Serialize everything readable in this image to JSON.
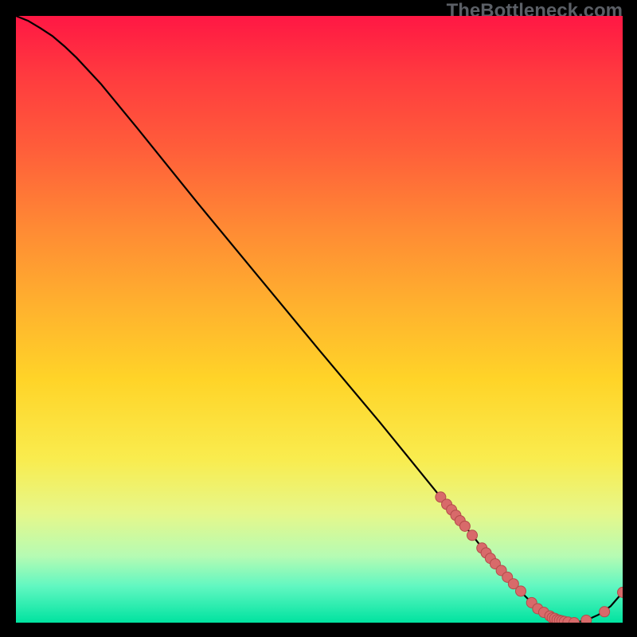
{
  "watermark": "TheBottleneck.com",
  "colors": {
    "page_bg": "#000000",
    "gradient_top": "#ff1744",
    "gradient_bottom": "#00e3a0",
    "curve": "#000000",
    "dot_fill": "#d86a6a",
    "dot_stroke": "#b44b4b"
  },
  "chart_data": {
    "type": "line",
    "title": "",
    "xlabel": "",
    "ylabel": "",
    "xlim": [
      0,
      100
    ],
    "ylim": [
      0,
      100
    ],
    "grid": false,
    "series": [
      {
        "name": "curve",
        "x": [
          0,
          2,
          4,
          6,
          8,
          10,
          14,
          20,
          30,
          40,
          50,
          60,
          70,
          75,
          78,
          80,
          82,
          84,
          86,
          88,
          90,
          92,
          94,
          96,
          98,
          100
        ],
        "y": [
          100,
          99.2,
          98.0,
          96.7,
          95.0,
          93.1,
          88.8,
          81.5,
          69.1,
          57.0,
          44.9,
          33.0,
          20.7,
          14.7,
          10.8,
          8.6,
          6.4,
          4.3,
          2.3,
          1.1,
          0.3,
          0.0,
          0.4,
          1.3,
          2.7,
          5.0
        ]
      }
    ],
    "dots": [
      {
        "x": 70.0,
        "y": 20.7
      },
      {
        "x": 71.0,
        "y": 19.5
      },
      {
        "x": 71.8,
        "y": 18.6
      },
      {
        "x": 72.5,
        "y": 17.7
      },
      {
        "x": 73.2,
        "y": 16.8
      },
      {
        "x": 74.0,
        "y": 15.9
      },
      {
        "x": 75.2,
        "y": 14.4
      },
      {
        "x": 76.8,
        "y": 12.3
      },
      {
        "x": 77.5,
        "y": 11.5
      },
      {
        "x": 78.2,
        "y": 10.6
      },
      {
        "x": 79.0,
        "y": 9.7
      },
      {
        "x": 80.0,
        "y": 8.6
      },
      {
        "x": 81.0,
        "y": 7.5
      },
      {
        "x": 82.0,
        "y": 6.4
      },
      {
        "x": 83.2,
        "y": 5.2
      },
      {
        "x": 85.0,
        "y": 3.3
      },
      {
        "x": 86.0,
        "y": 2.3
      },
      {
        "x": 87.0,
        "y": 1.7
      },
      {
        "x": 88.0,
        "y": 1.1
      },
      {
        "x": 88.4,
        "y": 0.8
      },
      {
        "x": 88.8,
        "y": 0.7
      },
      {
        "x": 89.2,
        "y": 0.5
      },
      {
        "x": 89.6,
        "y": 0.4
      },
      {
        "x": 90.0,
        "y": 0.3
      },
      {
        "x": 90.4,
        "y": 0.2
      },
      {
        "x": 91.0,
        "y": 0.1
      },
      {
        "x": 92.0,
        "y": 0.0
      },
      {
        "x": 94.0,
        "y": 0.4
      },
      {
        "x": 97.0,
        "y": 1.8
      },
      {
        "x": 100.0,
        "y": 5.0
      }
    ]
  }
}
